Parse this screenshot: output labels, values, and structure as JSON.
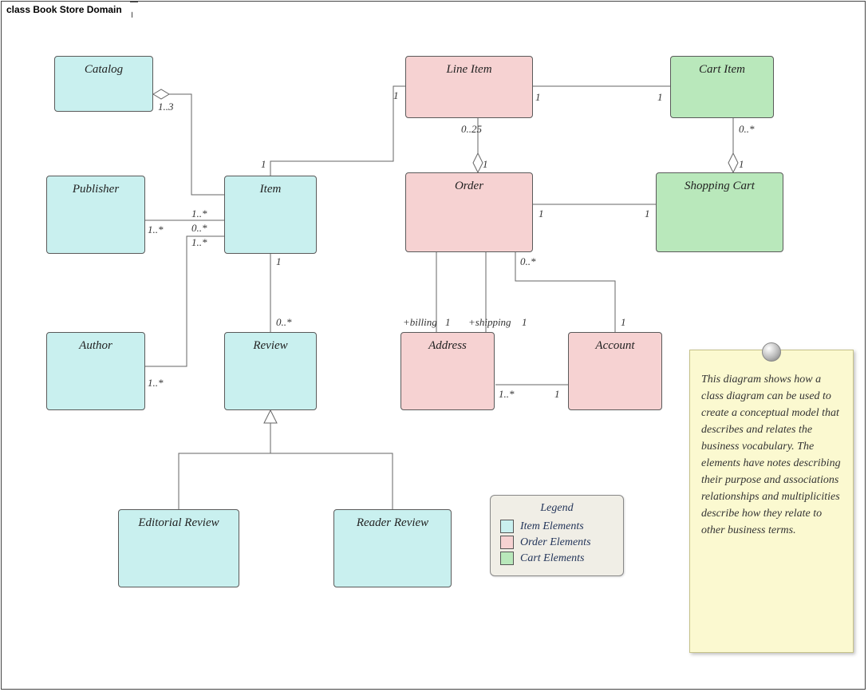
{
  "title": "class Book Store Domain",
  "boxes": {
    "catalog": "Catalog",
    "publisher": "Publisher",
    "item": "Item",
    "author": "Author",
    "review": "Review",
    "editorialReview": "Editorial Review",
    "readerReview": "Reader Review",
    "lineItem": "Line Item",
    "order": "Order",
    "address": "Address",
    "account": "Account",
    "cartItem": "Cart Item",
    "shoppingCart": "Shopping Cart"
  },
  "mult": {
    "catalog_item": "1..3",
    "item_catalog": "1",
    "publisher_item": "1..*",
    "item_publisher_l1": "1..*",
    "item_publisher_l2": "0..*",
    "item_publisher_l3": "1..*",
    "author_item": "1..*",
    "item_review_top": "1",
    "item_review_bot": "0..*",
    "lineitem_item": "1",
    "lineitem_order": "1",
    "order_lineitem": "0..25",
    "order_lineitem_end": "1",
    "lineitem_cartitem_l": "1",
    "lineitem_cartitem_r": "1",
    "cartitem_shop": "0..*",
    "shop_cart_end": "1",
    "order_shop_l": "1",
    "order_shop_r": "1",
    "order_account_top": "0..*",
    "order_account_bot": "1",
    "order_addr_bill": "1",
    "order_addr_ship": "1",
    "addr_billing": "+billing",
    "addr_shipping": "+shipping",
    "address_account_l": "1..*",
    "address_account_r": "1"
  },
  "legend": {
    "title": "Legend",
    "item": "Item Elements",
    "order": "Order Elements",
    "cart": "Cart Elements"
  },
  "note_text": "This diagram shows how a class diagram can be used to create a conceptual model that describes and relates the business vocabulary. The elements have notes describing their purpose and associations relationships and multiplicities describe how they relate to other business terms.",
  "colors": {
    "cyan": "#c9f0ef",
    "pink": "#f6d2d2",
    "green": "#b9e8bb"
  }
}
